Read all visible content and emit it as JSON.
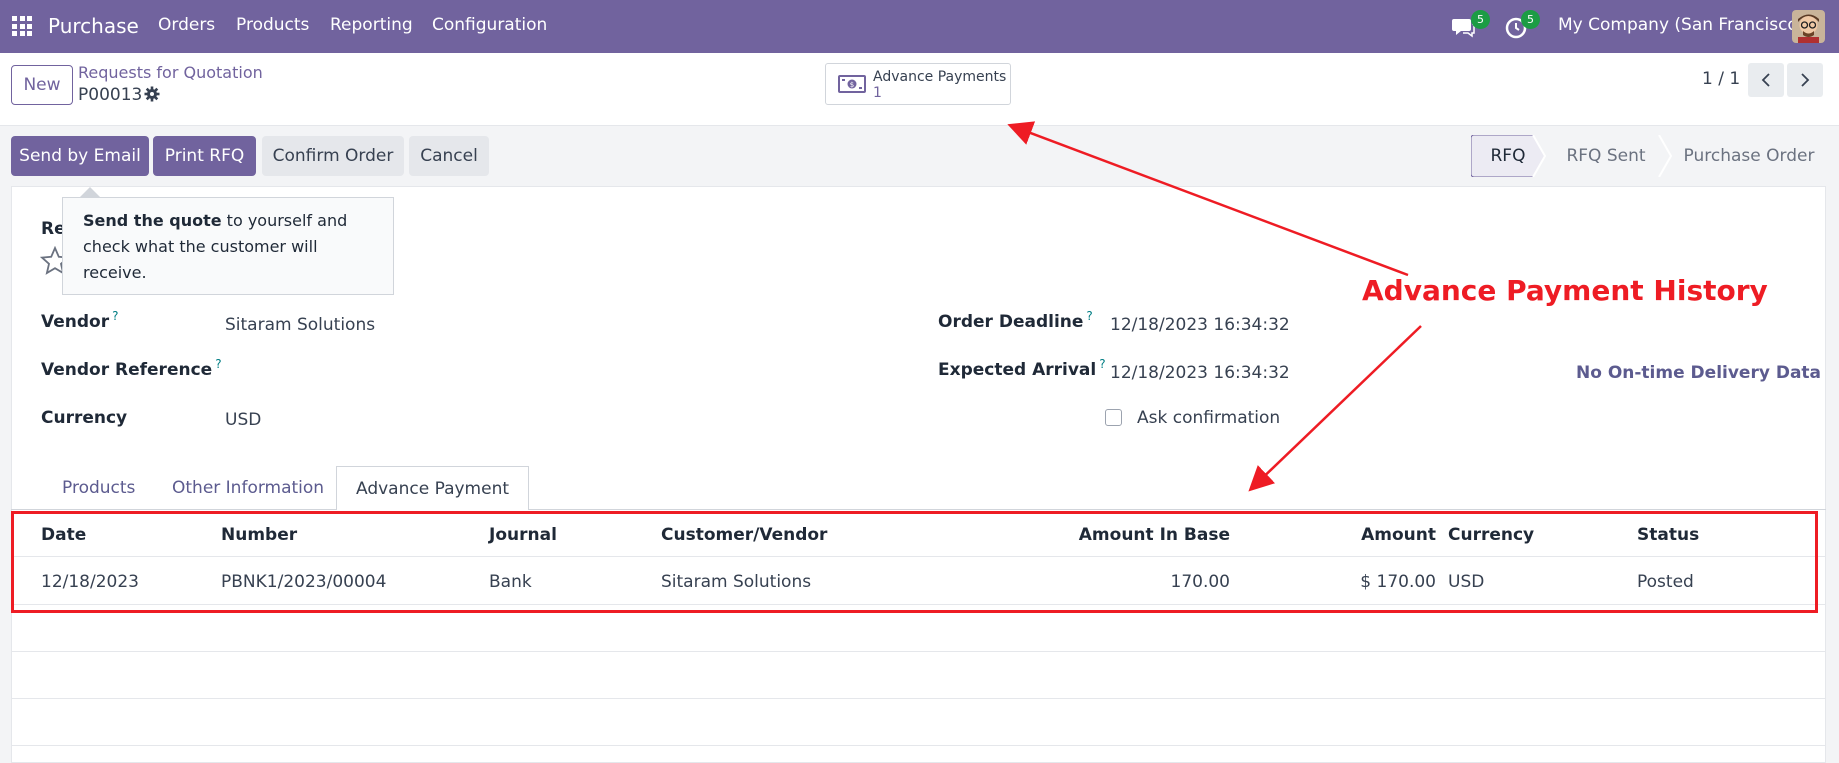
{
  "topbar": {
    "app_name": "Purchase",
    "menus": [
      "Orders",
      "Products",
      "Reporting",
      "Configuration"
    ],
    "chat_badge": "5",
    "activity_badge": "5",
    "company": "My Company (San Francisco)"
  },
  "control": {
    "new_label": "New",
    "breadcrumb_parent": "Requests for Quotation",
    "record_name": "P00013",
    "stat_label": "Advance Payments",
    "stat_value": "1",
    "pager": "1 / 1"
  },
  "actions": {
    "send_email": "Send by Email",
    "print_rfq": "Print RFQ",
    "confirm_order": "Confirm Order",
    "cancel": "Cancel"
  },
  "status_stages": [
    "RFQ",
    "RFQ Sent",
    "Purchase Order"
  ],
  "tooltip": {
    "bold": "Send the quote",
    "rest": " to yourself and check what the customer will receive."
  },
  "form": {
    "ref_label": "Re",
    "vendor_label": "Vendor",
    "vendor_value": "Sitaram Solutions",
    "vendor_ref_label": "Vendor Reference",
    "currency_label": "Currency",
    "currency_value": "USD",
    "order_deadline_label": "Order Deadline",
    "order_deadline_value": "12/18/2023 16:34:32",
    "expected_arrival_label": "Expected Arrival",
    "expected_arrival_value": "12/18/2023 16:34:32",
    "ask_confirmation_label": "Ask confirmation",
    "ontime_label": "No On-time Delivery Data",
    "help_mark": "?"
  },
  "tabs": [
    "Products",
    "Other Information",
    "Advance Payment"
  ],
  "table": {
    "headers": [
      "Date",
      "Number",
      "Journal",
      "Customer/Vendor",
      "Amount In Base",
      "Amount",
      "Currency",
      "Status"
    ],
    "rows": [
      [
        "12/18/2023",
        "PBNK1/2023/00004",
        "Bank",
        "Sitaram Solutions",
        "170.00",
        "$ 170.00",
        "USD",
        "Posted"
      ]
    ]
  },
  "annotation": "Advance Payment History",
  "colors": {
    "brand": "#71639e",
    "annotation_red": "#ee1c24",
    "badge_green": "#1c9c44"
  }
}
